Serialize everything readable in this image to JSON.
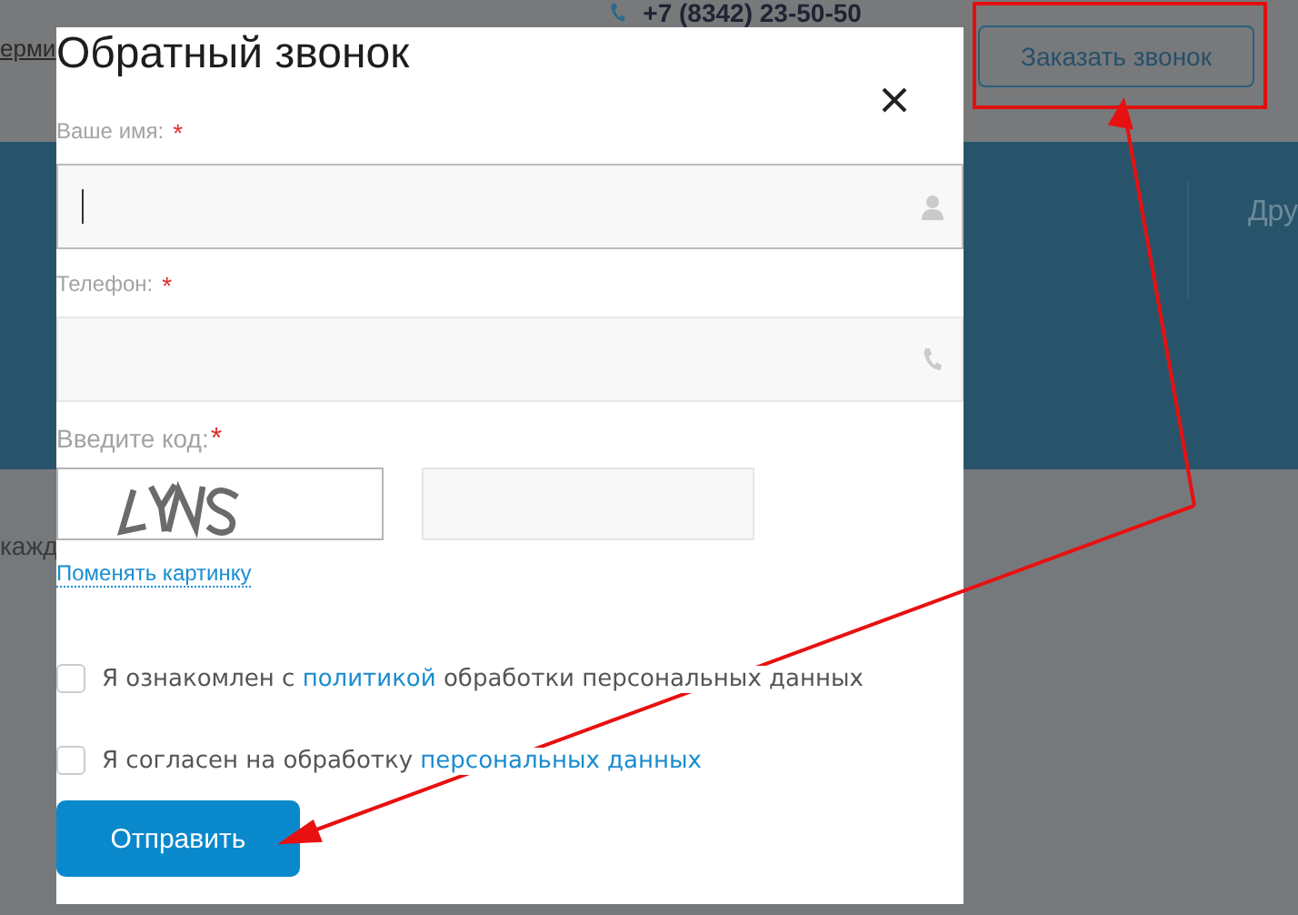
{
  "page": {
    "header_left_text": "ерми",
    "phone": "+7 (8342) 23-50-50",
    "callback_button": "Заказать звонок",
    "nav_item": "Дру",
    "body_text": "кажд"
  },
  "modal": {
    "title": "Обратный звонок",
    "fields": [
      {
        "label": "Ваше имя:",
        "required_mark": "*",
        "kind": "name",
        "focused": true
      },
      {
        "label": "Телефон:",
        "required_mark": "*",
        "kind": "phone",
        "focused": false
      }
    ],
    "captcha": {
      "label": "Введите код:",
      "required_mark": "*",
      "refresh_link": "Поменять картинку"
    },
    "agreements": [
      {
        "checked": false,
        "parts": [
          {
            "text": "Я ознакомлен с ",
            "link": false
          },
          {
            "text": "политикой",
            "link": true
          },
          {
            "text": " обработки персональных данных",
            "link": false
          }
        ]
      },
      {
        "checked": false,
        "parts": [
          {
            "text": "Я согласен на обработку ",
            "link": false
          },
          {
            "text": "персональных данных",
            "link": true
          }
        ]
      }
    ],
    "submit": "Отправить"
  }
}
